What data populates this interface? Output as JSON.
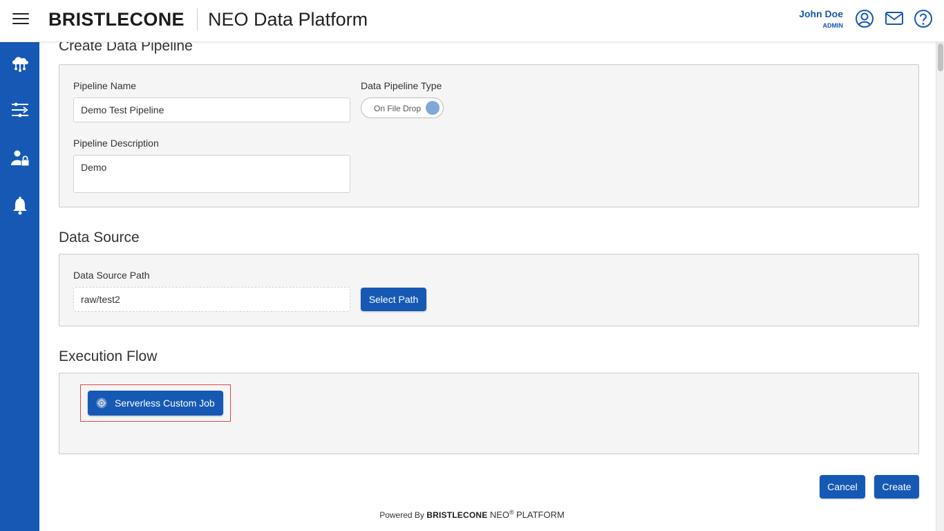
{
  "header": {
    "brand": "BRISTLECONE",
    "app_title": "NEO Data Platform",
    "user_name": "John Doe",
    "user_role": "ADMIN",
    "icons": [
      "user-circle-icon",
      "mail-icon",
      "help-icon"
    ]
  },
  "sidebar": {
    "items": [
      {
        "icon": "cloud-network-icon"
      },
      {
        "icon": "pipeline-flow-icon"
      },
      {
        "icon": "user-lock-icon"
      },
      {
        "icon": "bell-icon"
      }
    ]
  },
  "create_pipeline": {
    "title": "Create Data Pipeline",
    "name_label": "Pipeline Name",
    "name_value": "Demo Test Pipeline",
    "type_label": "Data Pipeline Type",
    "type_toggle_label": "On File Drop",
    "description_label": "Pipeline Description",
    "description_value": "Demo"
  },
  "data_source": {
    "title": "Data Source",
    "path_label": "Data Source Path",
    "path_value": "raw/test2",
    "select_button": "Select Path"
  },
  "execution_flow": {
    "title": "Execution Flow",
    "job_button": "Serverless Custom Job"
  },
  "actions": {
    "cancel": "Cancel",
    "create": "Create"
  },
  "footer": {
    "powered_by": "Powered By",
    "brand": "BRISTLECONE",
    "neo": "NEO",
    "registered": "®",
    "platform": "PLATFORM"
  },
  "colors": {
    "primary": "#1559b5",
    "highlight_border": "#e04848"
  }
}
